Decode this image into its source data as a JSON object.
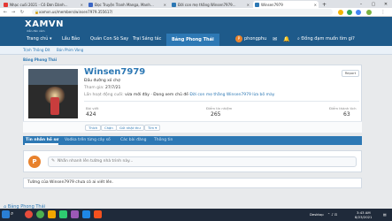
{
  "browser": {
    "tabs": [
      {
        "title": "Nhạc cuối 2021 - Cô Đơn Dành..."
      },
      {
        "title": "Đọc Truyện Tranh Manga, Manh..."
      },
      {
        "title": "Đời con mẹ thằng Winsen7979..."
      },
      {
        "title": "Winsen7979"
      }
    ],
    "address": "xamvn.us/members/winsen7979.355617/"
  },
  "site": {
    "logo": "XAMVN",
    "logo_sub": "diễn đàn xàm",
    "nav": [
      "Trang chủ",
      "Lầu Bảo",
      "Quán Con Sò Say",
      "Trại Sáng tác",
      "Bảng Phong Thái"
    ],
    "username": "phongphu",
    "user_initial": "P",
    "search_label": "Đồng đạm muốn tìm gì?",
    "sub_nav": [
      "Trịnh Thông Đít",
      "Bán Phim Vàng"
    ]
  },
  "breadcrumb": "Bảng Phong Thái",
  "profile": {
    "name": "Winsen7979",
    "report": "Report",
    "title_line": "Đầu đường xó chợ",
    "joined_label": "Tham gia:",
    "joined_value": "27/7/21",
    "last_seen_label": "Lần hoạt động cuối:",
    "last_seen_value": "vừa mới đây · Đang xem chủ đề",
    "last_seen_link": "Đời con mẹ thằng Winsen7979 lừa bố mày",
    "stats": [
      {
        "label": "Bài viết",
        "value": "424"
      },
      {
        "label": "Điểm tín nhiệm",
        "value": "265"
      },
      {
        "label": "Điểm thành tích",
        "value": "63"
      }
    ],
    "actions": [
      "Thích",
      "Chặn",
      "Gửi nhật thư",
      "Tìm ▾"
    ]
  },
  "profile_tabs": [
    "Tin nhắn hồ sơ",
    "Vodka trên từng cây số",
    "Các bài đăng",
    "Thông tin"
  ],
  "composer": {
    "initial": "P",
    "placeholder": "Nhắn nhanh lên tường nhà trinh này..."
  },
  "empty_message": "Tường của Winsen7979 chưa có ai viết lên.",
  "footer_link": "Bảng Phong Thái",
  "taskbar": {
    "desktop_label": "Desktop",
    "time": "3:43 AM",
    "date": "8/23/2021"
  }
}
